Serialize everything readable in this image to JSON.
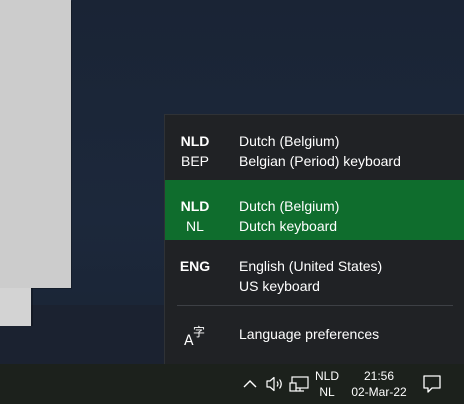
{
  "flyout": {
    "items": [
      {
        "code": "NLD",
        "layout_code": "BEP",
        "language": "Dutch (Belgium)",
        "keyboard": "Belgian (Period) keyboard",
        "selected": false
      },
      {
        "code": "NLD",
        "layout_code": "NL",
        "language": "Dutch (Belgium)",
        "keyboard": "Dutch keyboard",
        "selected": true
      },
      {
        "code": "ENG",
        "layout_code": "",
        "language": "English (United States)",
        "keyboard": "US keyboard",
        "selected": false
      }
    ],
    "preferences_label": "Language preferences",
    "preferences_icon": "language-settings-icon",
    "selected_color": "#0f6d2d"
  },
  "taskbar": {
    "input_indicator": {
      "line1": "NLD",
      "line2": "NL"
    },
    "clock": {
      "time": "21:56",
      "date": "02-Mar-22"
    },
    "icons": [
      "chevron-up-icon",
      "volume-icon",
      "network-icon",
      "notification-icon"
    ]
  }
}
